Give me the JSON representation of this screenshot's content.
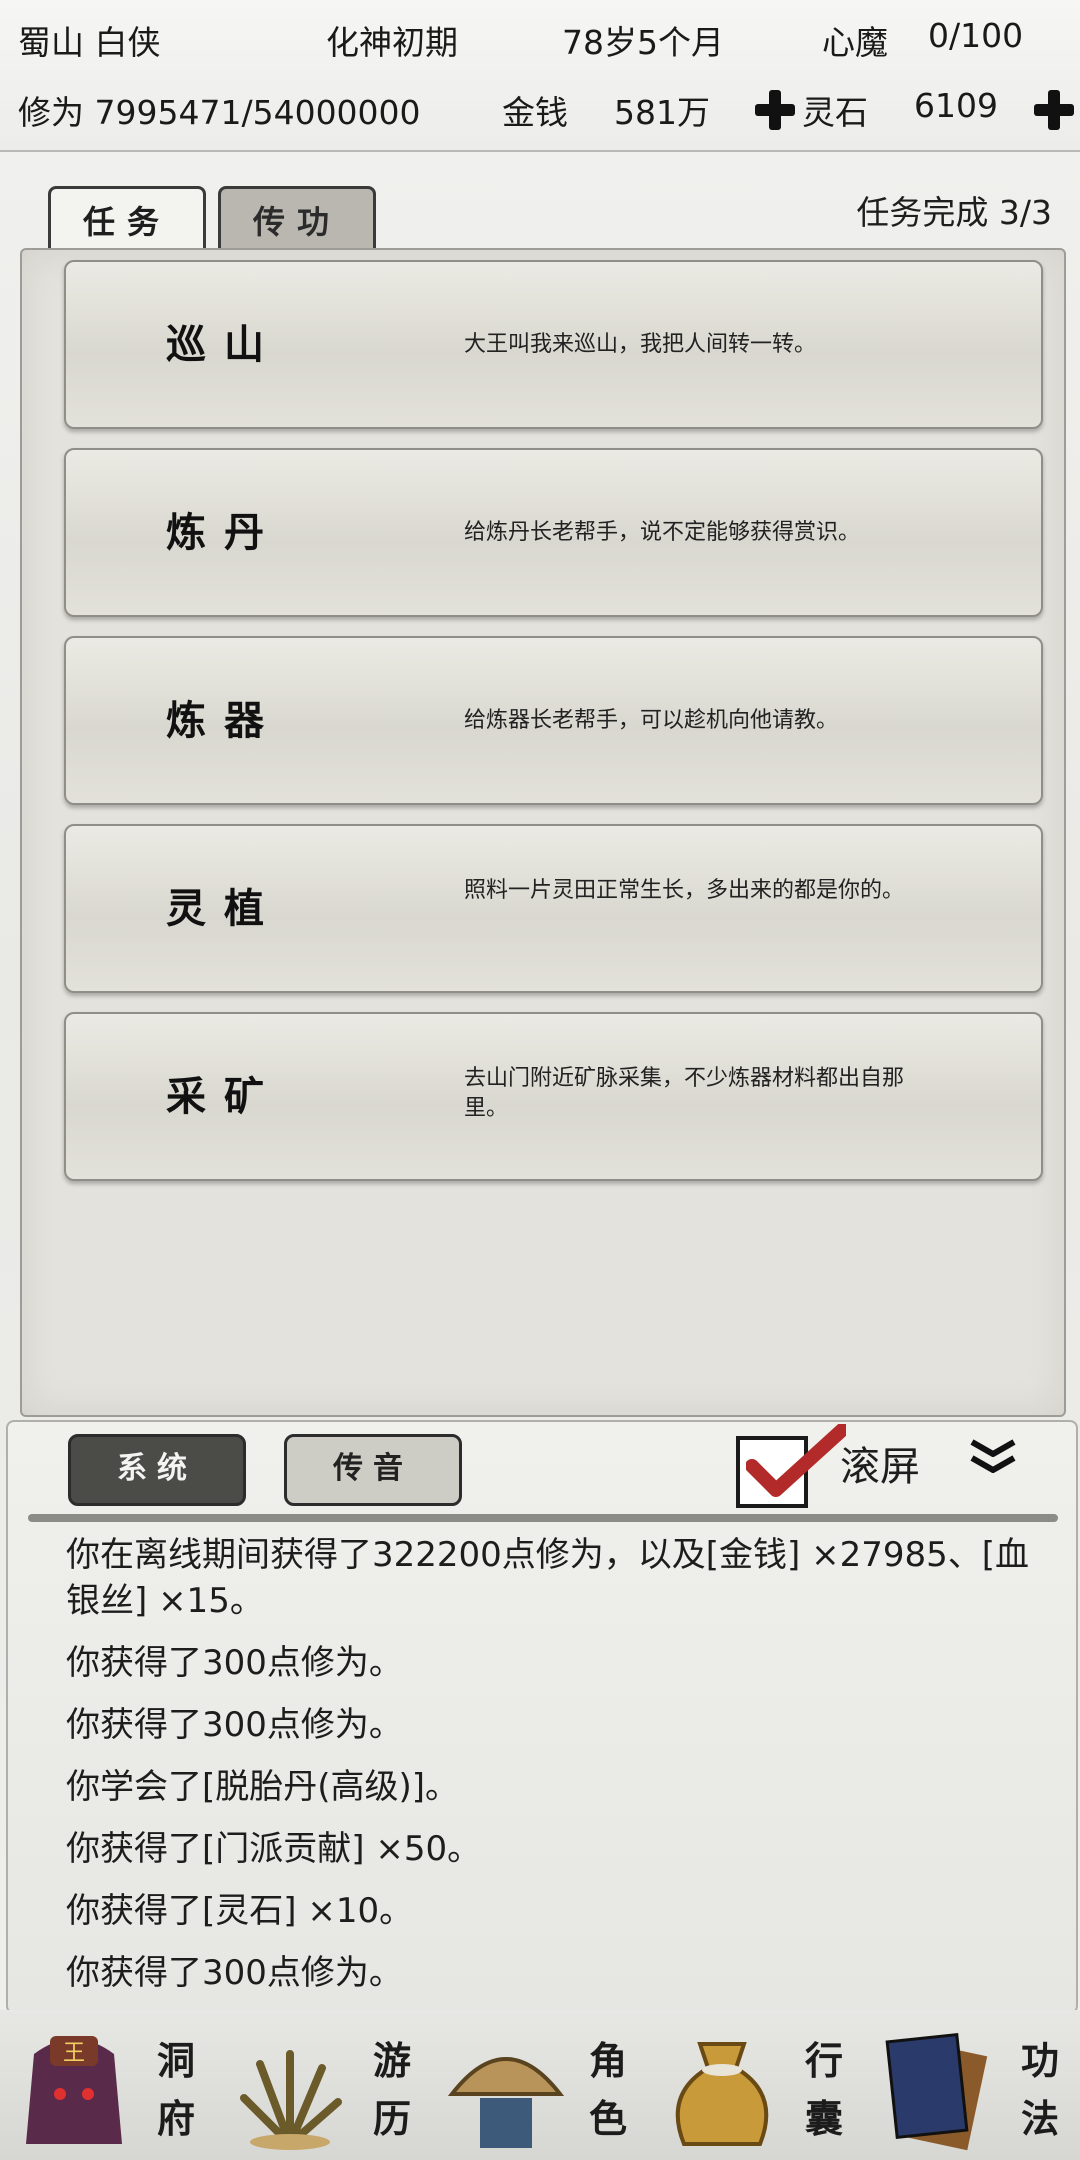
{
  "status": {
    "location": "蜀山 白侠",
    "realm": "化神初期",
    "age": "78岁5个月",
    "demon_label": "心魔",
    "demon_value": "0/100",
    "cultivation": "修为 7995471/54000000",
    "money_label": "金钱",
    "money_value": "581万",
    "stone_label": "灵石",
    "stone_value": "6109"
  },
  "tabs": [
    {
      "label": "任务",
      "active": true
    },
    {
      "label": "传功",
      "active": false
    }
  ],
  "task_progress": "任务完成  3/3",
  "tasks": [
    {
      "name": "巡山",
      "desc": "大王叫我来巡山，我把人间转一转。"
    },
    {
      "name": "炼丹",
      "desc": "给炼丹长老帮手，说不定能够获得赏识。"
    },
    {
      "name": "炼器",
      "desc": "给炼器长老帮手，可以趁机向他请教。"
    },
    {
      "name": "灵植",
      "desc": "照料一片灵田正常生长，多出来的都是你的。"
    },
    {
      "name": "采矿",
      "desc": "去山门附近矿脉采集，不少炼器材料都出自那里。"
    }
  ],
  "log": {
    "system_button": "系统",
    "message_button": "传音",
    "scroll_label": "滚屏",
    "scroll_checked": true,
    "lines": [
      "你在离线期间获得了322200点修为，以及[金钱] ×27985、[血银丝] ×15。",
      "你获得了300点修为。",
      "你获得了300点修为。",
      "你学会了[脱胎丹(高级)]。",
      "你获得了[门派贡献] ×50。",
      "你获得了[灵石] ×10。",
      "你获得了300点修为。"
    ]
  },
  "nav": [
    {
      "label": "洞府",
      "icon": "demon-king-icon"
    },
    {
      "label": "游历",
      "icon": "herb-icon"
    },
    {
      "label": "角色",
      "icon": "straw-hat-icon"
    },
    {
      "label": "行囊",
      "icon": "pouch-icon"
    },
    {
      "label": "功法",
      "icon": "books-icon"
    }
  ]
}
